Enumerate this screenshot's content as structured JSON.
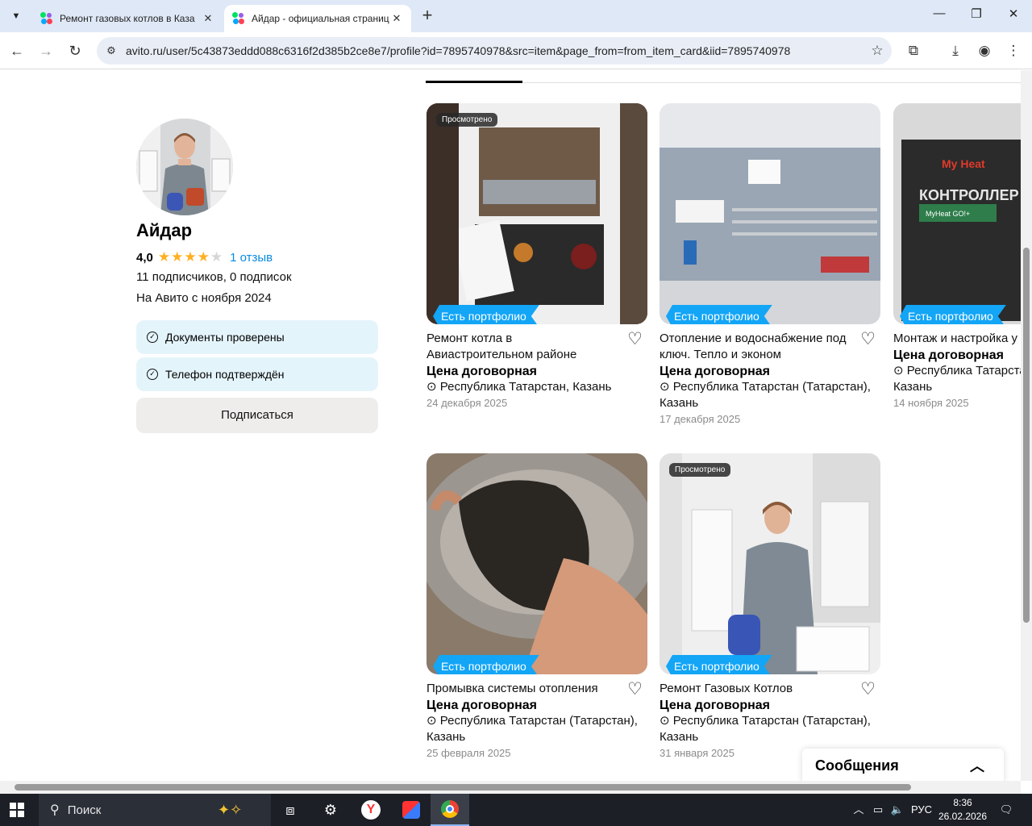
{
  "browser": {
    "tabs": [
      {
        "title": "Ремонт газовых котлов в Каза",
        "active": false
      },
      {
        "title": "Айдар - официальная страниц",
        "active": true
      }
    ],
    "url": "avito.ru/user/5c43873eddd088c6316f2d385b2ce8e7/profile?id=7895740978&src=item&page_from=from_item_card&iid=7895740978"
  },
  "seller": {
    "name": "Айдар",
    "rating": "4,0",
    "stars_filled": 4,
    "reviews": "1 отзыв",
    "followers": "11 подписчиков, 0 подписок",
    "since": "На Авито с ноября 2024",
    "badges": [
      "Документы проверены",
      "Телефон подтверждён"
    ],
    "subscribe_label": "Подписаться"
  },
  "listings": [
    {
      "title": "Ремонт котла в Авиастроительном районе",
      "price": "Цена договорная",
      "location": "Республика Татарстан, Казань",
      "date": "24 декабря 2025",
      "viewed": "Просмотрено",
      "portfolio": "Есть портфолио"
    },
    {
      "title": "Отопление и водоснабжение под ключ. Тепло и эконом",
      "price": "Цена договорная",
      "location": "Республика Татарстан (Татарстан), Казань",
      "date": "17 декабря 2025",
      "viewed": "",
      "portfolio": "Есть портфолио"
    },
    {
      "title": "Монтаж и настройка у отопления My Heat",
      "price": "Цена договорная",
      "location": "Республика Татарстан (Татарстан), Казань",
      "date": "14 ноября 2025",
      "viewed": "",
      "portfolio": "Есть портфолио",
      "image_text": [
        "My Heat",
        "КОНТРОЛЛЕР",
        "MyHeat GO!+"
      ]
    },
    {
      "title": "Промывка системы отопления",
      "price": "Цена договорная",
      "location": "Республика Татарстан (Татарстан), Казань",
      "date": "25 февраля 2025",
      "viewed": "",
      "portfolio": "Есть портфолио"
    },
    {
      "title": "Ремонт Газовых Котлов",
      "price": "Цена договорная",
      "location": "Республика Татарстан (Татарстан), Казань",
      "date": "31 января 2025",
      "viewed": "Просмотрено",
      "portfolio": "Есть портфолио"
    }
  ],
  "messages": {
    "label": "Сообщения"
  },
  "taskbar": {
    "search_placeholder": "Поиск",
    "lang": "РУС",
    "time": "8:36",
    "date": "26.02.2026"
  },
  "colors": {
    "accent": "#13a5f6",
    "link": "#0a8be0",
    "star": "#ffb021",
    "badge_bg": "#e4f4fb"
  },
  "icons": [
    "tab-list-icon",
    "close-icon",
    "new-tab-icon",
    "back-icon",
    "forward-icon",
    "reload-icon",
    "site-settings-icon",
    "star-icon",
    "extensions-icon",
    "download-icon",
    "profile-icon",
    "menu-icon",
    "heart-icon",
    "location-pin-icon",
    "check-circle-icon",
    "chevron-up-icon",
    "windows-icon",
    "search-icon",
    "settings-icon"
  ]
}
